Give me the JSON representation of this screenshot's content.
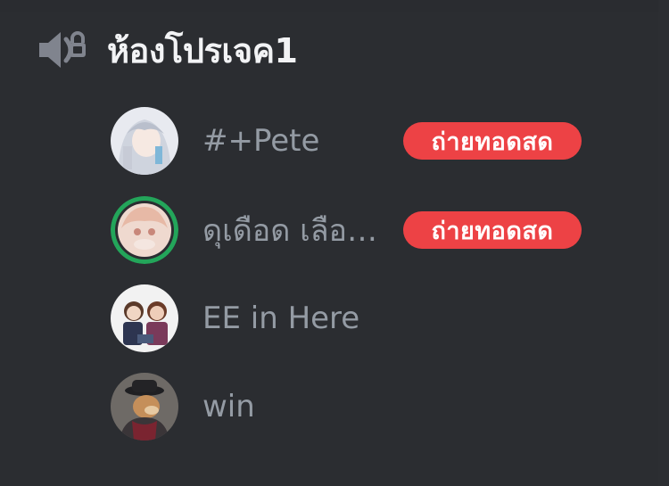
{
  "channel": {
    "icon": "speaker-lock-icon",
    "name": "ห้องโปรเจค1"
  },
  "colors": {
    "background": "#2b2d31",
    "live_badge": "#ed4245",
    "speaking_ring": "#23a55a",
    "username": "#949ba4",
    "channel_name": "#f2f3f5"
  },
  "members": [
    {
      "name": "#+Pete",
      "live": "ถ่ายทอดสด",
      "speaking": false
    },
    {
      "name": "ดุเดือด เลือด...",
      "live": "ถ่ายทอดสด",
      "speaking": true
    },
    {
      "name": "EE in Here",
      "live": "",
      "speaking": false
    },
    {
      "name": "win",
      "live": "",
      "speaking": false
    }
  ]
}
